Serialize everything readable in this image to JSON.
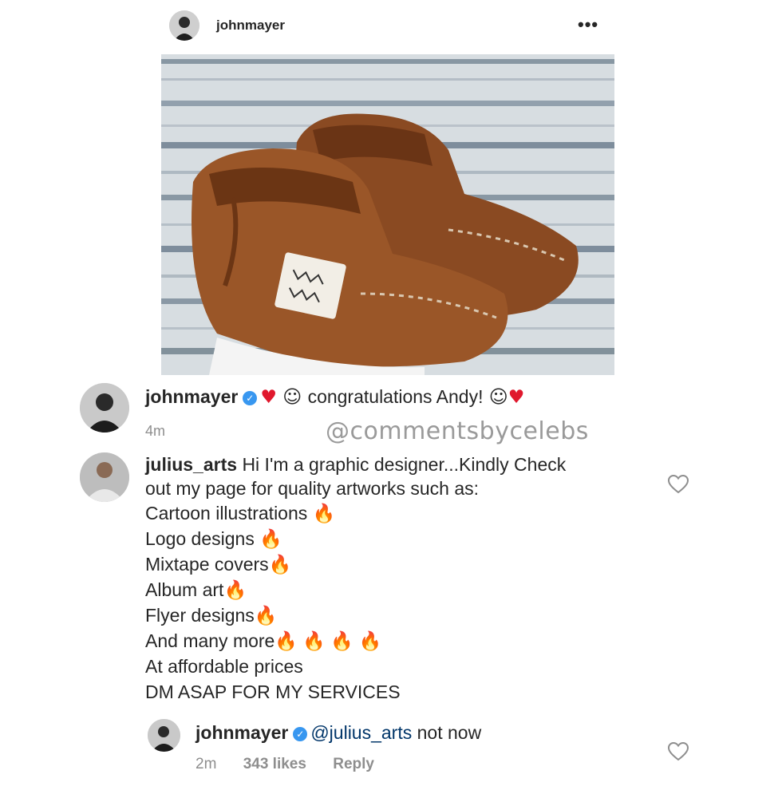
{
  "post": {
    "username": "johnmayer",
    "more_icon": "more-dots-icon",
    "image_label": "WA VM"
  },
  "caption": {
    "username": "johnmayer",
    "text": "congratulations Andy!",
    "time": "4m",
    "watermark": "@commentsbycelebs"
  },
  "comment1": {
    "username": "julius_arts",
    "first_line": "Hi I'm a graphic designer...Kindly Check",
    "second_line": "out my page for quality artworks such as:",
    "items": [
      "Cartoon illustrations ",
      "Logo designs ",
      "Mixtape covers",
      "Album art",
      "Flyer designs",
      "And many more"
    ],
    "prices": "At affordable prices",
    "dm": "DM ASAP FOR MY SERVICES"
  },
  "reply": {
    "username": "johnmayer",
    "mention": "@julius_arts",
    "text": " not now",
    "time": "2m",
    "likes": "343 likes",
    "reply_label": "Reply"
  },
  "colors": {
    "verified": "#3897f0",
    "mention": "#003569",
    "meta": "#8e8e8e",
    "heart": "#e0182d",
    "fire": "#f26a0f"
  }
}
